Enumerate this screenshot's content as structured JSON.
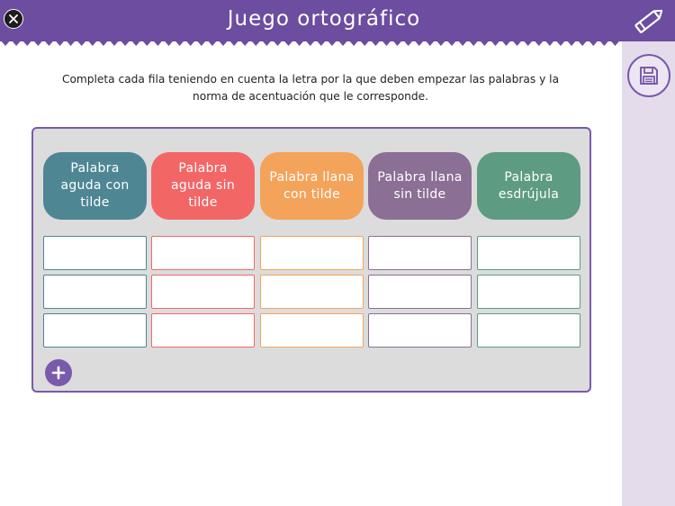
{
  "header": {
    "title": "Juego ortográfico",
    "close_icon": "close-icon",
    "edit_icon": "pencil-icon"
  },
  "sidebar": {
    "save_icon": "save-icon"
  },
  "instructions": "Completa cada fila teniendo en cuenta la letra por la que deben empezar las palabras y la norma de acentuación que le corresponde.",
  "table": {
    "columns": [
      {
        "label": "Palabra aguda con tilde",
        "color": "#4e8694"
      },
      {
        "label": "Palabra aguda sin tilde",
        "color": "#f36666"
      },
      {
        "label": "Palabra llana con tilde",
        "color": "#f4a35a"
      },
      {
        "label": "Palabra llana sin tilde",
        "color": "#8b6f95"
      },
      {
        "label": "Palabra esdrújula",
        "color": "#5d9b82"
      }
    ],
    "rows": [
      [
        "",
        "",
        "",
        "",
        ""
      ],
      [
        "",
        "",
        "",
        "",
        ""
      ],
      [
        "",
        "",
        "",
        "",
        ""
      ]
    ],
    "add_row_icon": "plus-icon"
  },
  "colors": {
    "header": "#6c4d9f",
    "accent": "#7a5aab",
    "sidebar": "#e4dcea",
    "board": "#dcdcdc"
  }
}
